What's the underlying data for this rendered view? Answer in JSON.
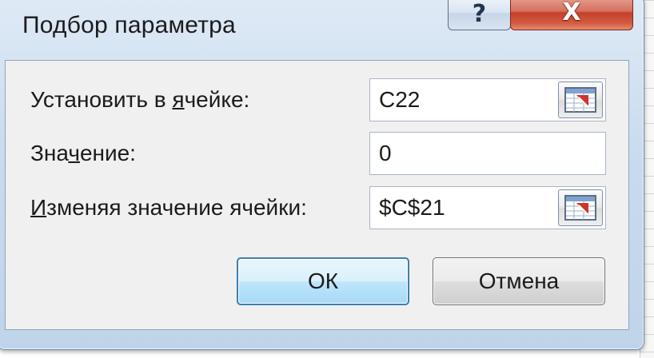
{
  "dialog": {
    "title": "Подбор параметра",
    "help_label": "?",
    "close_label": "X"
  },
  "fields": {
    "set_cell": {
      "label_before": "Установить в ",
      "label_accel": "я",
      "label_after": "чейке:",
      "value": "C22"
    },
    "to_value": {
      "label_before": "Зна",
      "label_accel": "ч",
      "label_after": "ение:",
      "value": "0"
    },
    "by_changing": {
      "label_before": "",
      "label_accel": "И",
      "label_after": "зменяя значение ячейки:",
      "value": "$C$21"
    }
  },
  "buttons": {
    "ok_label": "ОК",
    "cancel_label": "Отмена"
  },
  "colors": {
    "close_button": "#c4402a",
    "ok_border": "#3c7fb1",
    "ref_arrow": "#d0352b"
  },
  "icons": {
    "ref_button_icon": "range-select-icon",
    "help_icon": "help-icon",
    "close_icon": "close-icon"
  }
}
